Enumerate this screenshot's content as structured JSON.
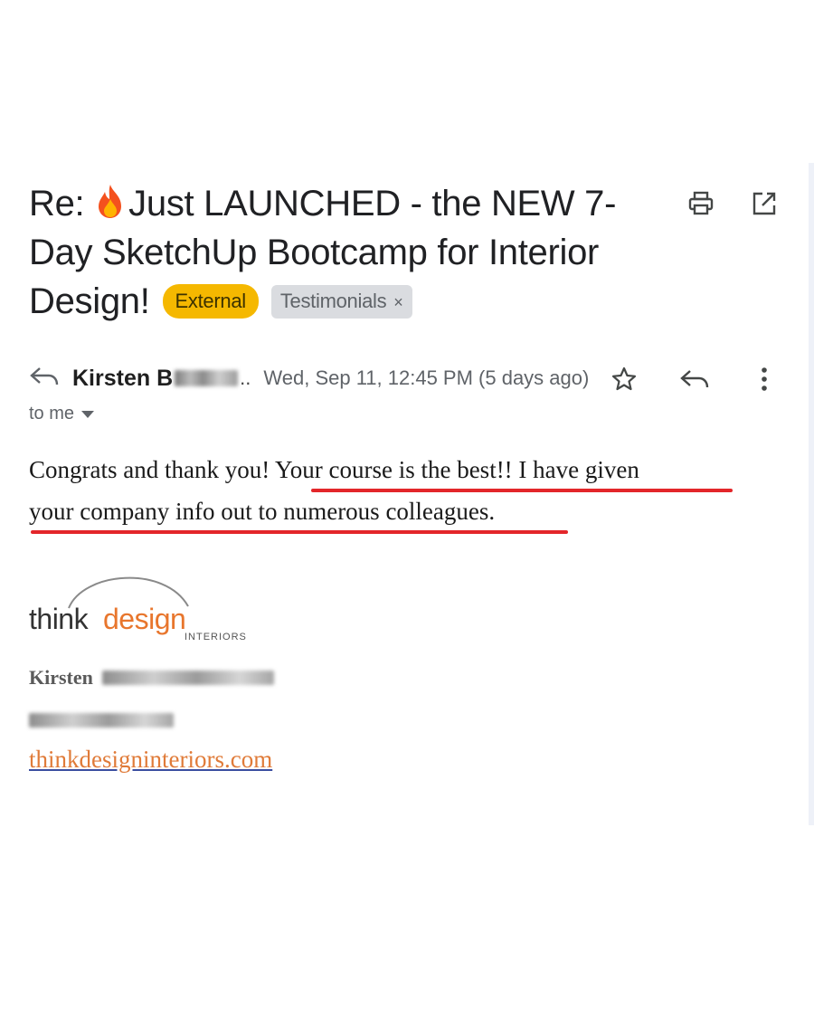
{
  "email": {
    "subject_prefix": "Re: ",
    "subject_main": "Just LAUNCHED - the NEW 7-Day SketchUp Bootcamp for Interior Design!",
    "labels": {
      "external": "External",
      "testimonials": "Testimonials",
      "remove_label_glyph": "×"
    },
    "icons": {
      "subject": "fire-emoji-icon",
      "print": "print-icon",
      "open_new_window": "open-in-new-window-icon",
      "reply_indicator": "reply-arrow-icon",
      "star": "star-icon",
      "reply": "reply-icon",
      "more": "more-vertical-icon",
      "recipients_caret": "caret-down-icon"
    },
    "sender": {
      "name": "Kirsten B",
      "ellipsis": "..",
      "date": "Wed, Sep 11, 12:45 PM (5 days ago)",
      "to": "to me"
    },
    "body": {
      "line1": "Congrats and thank you! Your course is the best!! I have given",
      "line2": "your company info out to numerous colleagues."
    },
    "signature": {
      "logo_think": "think",
      "logo_design": "design",
      "logo_interiors": "INTERIORS",
      "name": "Kirsten",
      "website": "thinkdesigninteriors.com"
    },
    "colors": {
      "highlight_underline": "#e3262a",
      "external_chip": "#f5b800",
      "label_chip": "#dadce0",
      "logo_accent": "#e8762d",
      "link": "#e07b39"
    }
  }
}
